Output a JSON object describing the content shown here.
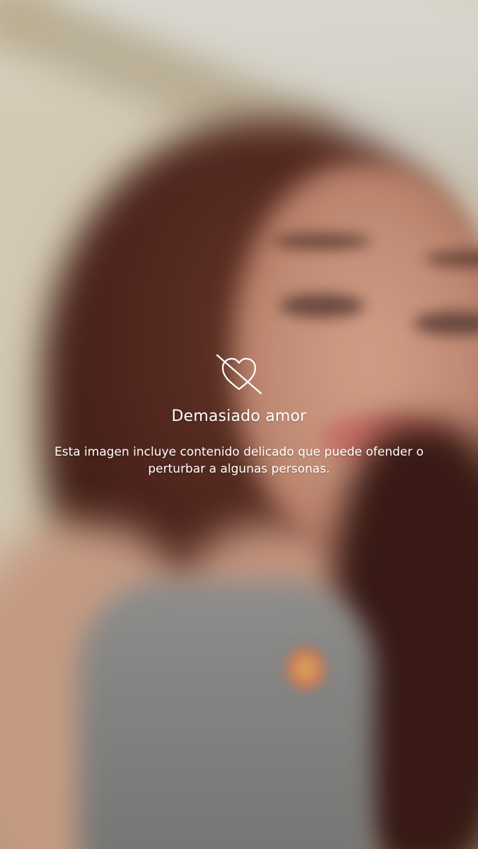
{
  "sensitive_overlay": {
    "icon": "crossed-heart-icon",
    "title": "Demasiado amor",
    "message": "Esta imagen incluye contenido delicado que puede ofender o perturbar a algunas personas."
  },
  "background": {
    "content": "blurred-photo"
  }
}
